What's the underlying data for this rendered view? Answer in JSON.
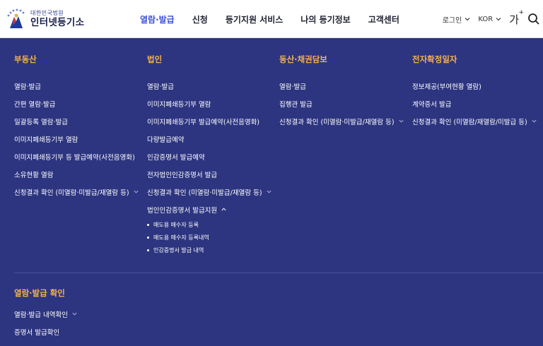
{
  "logo": {
    "sub": "대한민국법원",
    "main": "인터넷등기소"
  },
  "gnb": [
    {
      "label": "열람·발급",
      "active": true
    },
    {
      "label": "신청",
      "active": false
    },
    {
      "label": "등기지원 서비스",
      "active": false
    },
    {
      "label": "나의 등기정보",
      "active": false
    },
    {
      "label": "고객센터",
      "active": false
    }
  ],
  "utils": {
    "login": "로그인",
    "language": "KOR",
    "font_size": "가",
    "font_size_plus": "+"
  },
  "columns": [
    {
      "title": "부동산",
      "items": [
        {
          "label": "열람·발급"
        },
        {
          "label": "간편 열람·발급"
        },
        {
          "label": "일괄등록 열람·발급"
        },
        {
          "label": "이미지폐쇄등기부 열람"
        },
        {
          "label": "이미지폐쇄등기부 등 발급예약(사전음영화)"
        },
        {
          "label": "소유현황 열람"
        },
        {
          "label": "신청결과 확인 (미열람·미발급/재열람 등)",
          "chevron": "down"
        }
      ]
    },
    {
      "title": "법인",
      "items": [
        {
          "label": "열람·발급"
        },
        {
          "label": "이미지폐쇄등기부 열람"
        },
        {
          "label": "이미지폐쇄등기부 발급예약(사전음영화)"
        },
        {
          "label": "다량발급예약"
        },
        {
          "label": "인감증명서 발급예약"
        },
        {
          "label": "전자법인인감증명서 발급"
        },
        {
          "label": "신청결과 확인 (미열람·미발급/재열람 등)",
          "chevron": "down"
        },
        {
          "label": "법인인감증명서 발급지원",
          "chevron": "up"
        }
      ],
      "sub_items": [
        {
          "label": "매도용 매수자 등록"
        },
        {
          "label": "매도용 매수자 등록내역"
        },
        {
          "label": "인감증명서 발급 내역"
        }
      ]
    },
    {
      "title": "동산·채권담보",
      "items": [
        {
          "label": "열람·발급"
        },
        {
          "label": "집행관 발급"
        },
        {
          "label": "신청결과 확인 (미열람·미발급/재열람 등)",
          "chevron": "down"
        }
      ]
    },
    {
      "title": "전자확정일자",
      "items": [
        {
          "label": "정보제공(부여현황 열람)"
        },
        {
          "label": "계약증서 발급"
        },
        {
          "label": "신청결과 확인 (미열람/재열람/미발급 등)",
          "chevron": "down"
        }
      ]
    }
  ],
  "bottom": {
    "title": "열람·발급 확인",
    "items": [
      {
        "label": "열람·발급 내역확인",
        "chevron": "down"
      },
      {
        "label": "증명서 발급확인"
      }
    ]
  },
  "colors": {
    "panel_bg": "#2d3580",
    "title": "#f5b14c",
    "gnb_active": "#3b4fd8"
  }
}
